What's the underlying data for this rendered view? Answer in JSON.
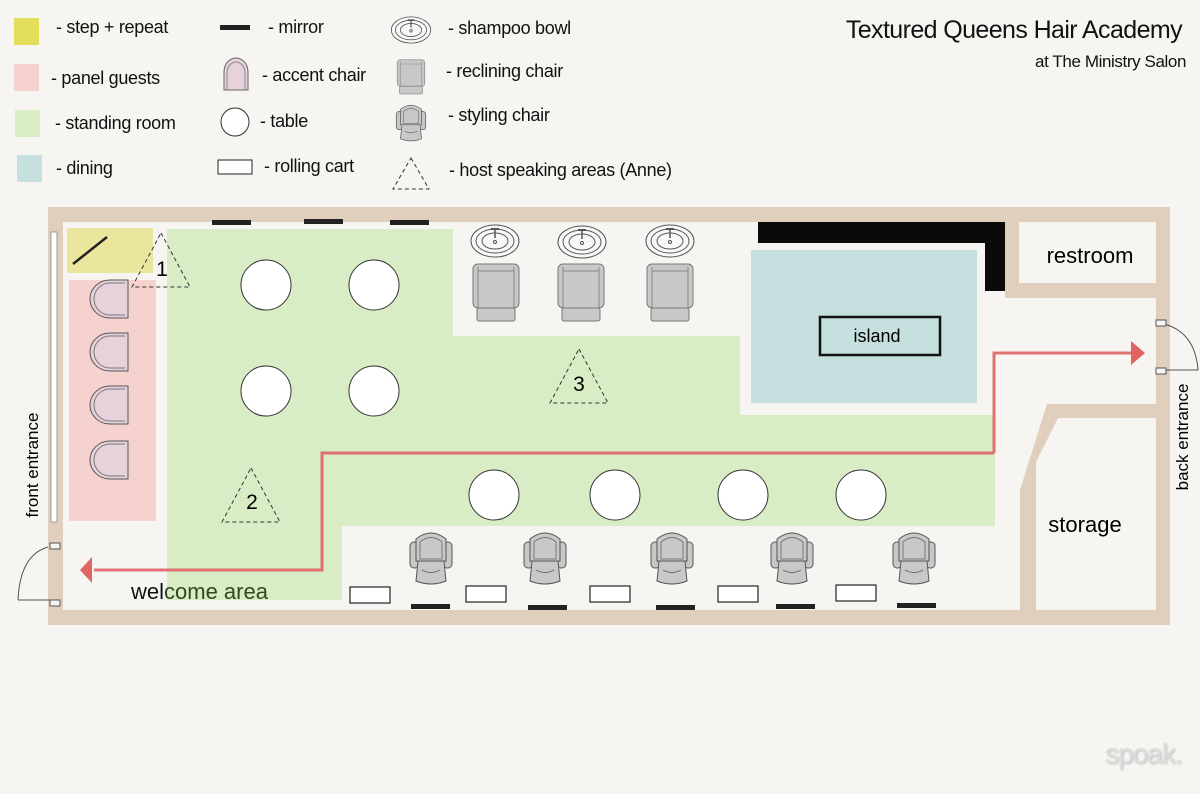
{
  "header": {
    "title": "Textured Queens Hair Academy",
    "subtitle": "at The Ministry Salon"
  },
  "legend": {
    "colors": [
      {
        "label": "- step + repeat",
        "color": "#e4df5a"
      },
      {
        "label": "- panel guests",
        "color": "#f6d2cf"
      },
      {
        "label": "- standing room",
        "color": "#d8ecc5"
      },
      {
        "label": "- dining",
        "color": "#c5e0df"
      }
    ],
    "icons": [
      {
        "label": "- mirror",
        "icon": "mirror-icon"
      },
      {
        "label": "-  accent chair",
        "icon": "accent-chair-icon"
      },
      {
        "label": "-  table",
        "icon": "table-icon"
      },
      {
        "label": "-  rolling cart",
        "icon": "rolling-cart-icon"
      },
      {
        "label": "- shampoo bowl",
        "icon": "shampoo-bowl-icon"
      },
      {
        "label": "- reclining chair",
        "icon": "reclining-chair-icon"
      },
      {
        "label": "- styling chair",
        "icon": "styling-chair-icon"
      },
      {
        "label": "- host speaking areas (Anne)",
        "icon": "speaking-area-icon"
      }
    ]
  },
  "plan": {
    "rooms": {
      "restroom": "restroom",
      "storage": "storage",
      "island": "island"
    },
    "entrances": {
      "front": "front entrance",
      "back": "back entrance"
    },
    "welcome_area": {
      "part1": "wel",
      "part2": "come area"
    },
    "speaking_areas": [
      "1",
      "2",
      "3"
    ],
    "colors": {
      "wall": "#dfcfbc",
      "path_arrow": "#e06464",
      "counter": "#0a0a0a"
    }
  },
  "watermark": "spoak."
}
